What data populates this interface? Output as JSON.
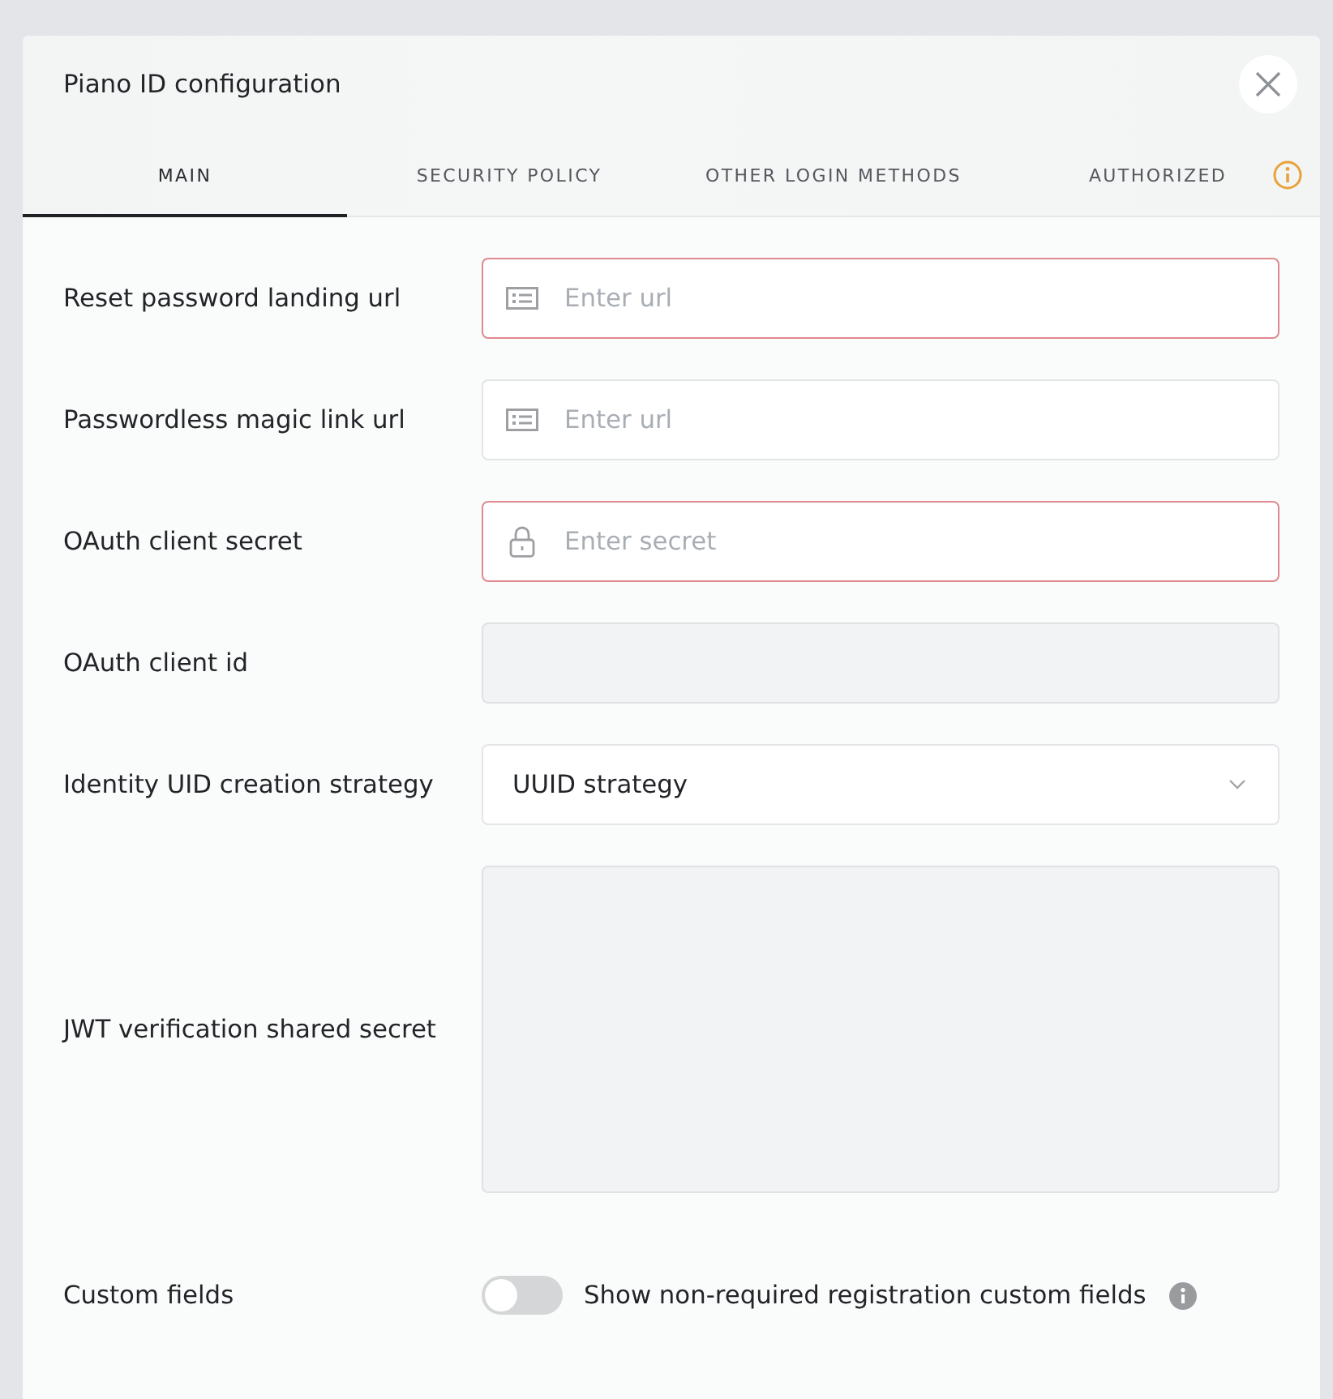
{
  "dialog": {
    "title": "Piano ID configuration"
  },
  "tabs": [
    {
      "label": "MAIN",
      "selected": true
    },
    {
      "label": "SECURITY POLICY",
      "selected": false
    },
    {
      "label": "OTHER LOGIN METHODS",
      "selected": false
    },
    {
      "label": "AUTHORIZED",
      "selected": false
    }
  ],
  "fields": [
    {
      "kind": "url",
      "label": "Reset password landing url",
      "placeholder": "Enter url",
      "invalid": true
    },
    {
      "kind": "url",
      "label": "Passwordless magic link url",
      "placeholder": "Enter url",
      "invalid": false
    },
    {
      "kind": "secret",
      "label": "OAuth client secret",
      "placeholder": "Enter secret",
      "invalid": true
    },
    {
      "kind": "text",
      "label": "OAuth client id",
      "disabled": true
    },
    {
      "kind": "select",
      "label": "Identity UID creation strategy",
      "value": "UUID strategy"
    },
    {
      "kind": "textarea",
      "label": "JWT verification shared secret",
      "disabled": true
    },
    {
      "kind": "toggle",
      "label": "Custom fields",
      "text": "Show non-required registration custom fields",
      "on": false
    }
  ]
}
